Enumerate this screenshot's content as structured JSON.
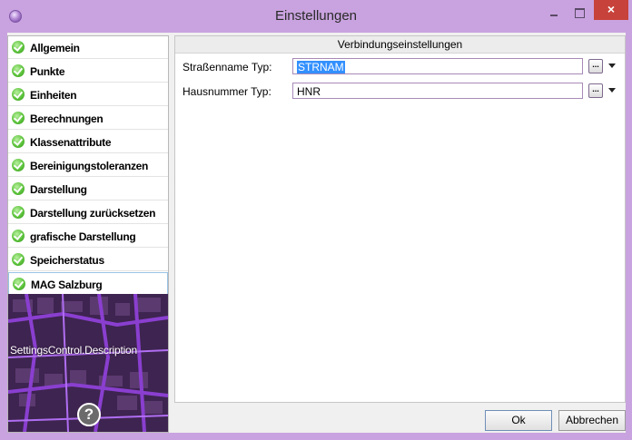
{
  "window": {
    "title": "Einstellungen",
    "close_glyph": "×"
  },
  "sidebar": {
    "items": [
      {
        "label": "Allgemein"
      },
      {
        "label": "Punkte"
      },
      {
        "label": "Einheiten"
      },
      {
        "label": "Berechnungen"
      },
      {
        "label": "Klassenattribute"
      },
      {
        "label": "Bereinigungstoleranzen"
      },
      {
        "label": "Darstellung"
      },
      {
        "label": "Darstellung zurücksetzen"
      },
      {
        "label": "grafische Darstellung"
      },
      {
        "label": "Speicherstatus"
      },
      {
        "label": "MAG Salzburg"
      }
    ],
    "selected": "MAG Salzburg",
    "description": "SettingsControl.Description",
    "help_glyph": "?"
  },
  "panel": {
    "header": "Verbindungseinstellungen",
    "rows": [
      {
        "label": "Straßenname Typ:",
        "value": "STRNAM",
        "button": "..."
      },
      {
        "label": "Hausnummer Typ:",
        "value": "HNR",
        "button": "..."
      }
    ]
  },
  "buttons": {
    "ok": "Ok",
    "cancel": "Abbrechen"
  },
  "colors": {
    "titlebar": "#c9a3df",
    "close": "#c7423a",
    "check": "#5cc33b",
    "selection": "#3390ff"
  }
}
